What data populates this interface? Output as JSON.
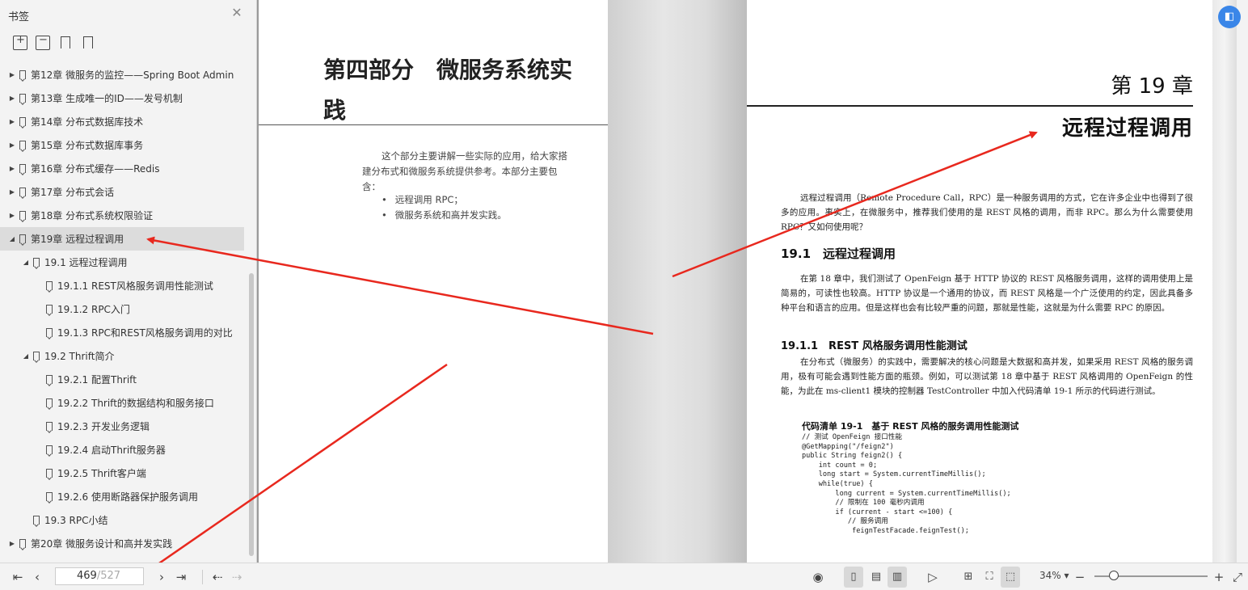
{
  "sidebar": {
    "title": "书签",
    "close_icon": "close-icon",
    "tools": [
      "expand-all-icon",
      "collapse-all-icon",
      "add-bookmark-icon",
      "bookmark-icon"
    ],
    "items": [
      {
        "label": "第12章 微服务的监控——Spring Boot Admin",
        "level": 0,
        "arrow": "▶"
      },
      {
        "label": "第13章 生成唯一的ID——发号机制",
        "level": 0,
        "arrow": "▶"
      },
      {
        "label": "第14章 分布式数据库技术",
        "level": 0,
        "arrow": "▶"
      },
      {
        "label": "第15章 分布式数据库事务",
        "level": 0,
        "arrow": "▶"
      },
      {
        "label": "第16章 分布式缓存——Redis",
        "level": 0,
        "arrow": "▶"
      },
      {
        "label": "第17章 分布式会话",
        "level": 0,
        "arrow": "▶"
      },
      {
        "label": "第18章 分布式系统权限验证",
        "level": 0,
        "arrow": "▶"
      },
      {
        "label": "第19章 远程过程调用",
        "level": 0,
        "arrow": "◢",
        "active": true
      },
      {
        "label": "19.1 远程过程调用",
        "level": 1,
        "arrow": "◢"
      },
      {
        "label": "19.1.1 REST风格服务调用性能测试",
        "level": 2,
        "arrow": ""
      },
      {
        "label": "19.1.2 RPC入门",
        "level": 2,
        "arrow": ""
      },
      {
        "label": "19.1.3 RPC和REST风格服务调用的对比",
        "level": 2,
        "arrow": ""
      },
      {
        "label": "19.2 Thrift简介",
        "level": 1,
        "arrow": "◢"
      },
      {
        "label": "19.2.1 配置Thrift",
        "level": 2,
        "arrow": ""
      },
      {
        "label": "19.2.2 Thrift的数据结构和服务接口",
        "level": 2,
        "arrow": ""
      },
      {
        "label": "19.2.3 开发业务逻辑",
        "level": 2,
        "arrow": ""
      },
      {
        "label": "19.2.4 启动Thrift服务器",
        "level": 2,
        "arrow": ""
      },
      {
        "label": "19.2.5 Thrift客户端",
        "level": 2,
        "arrow": ""
      },
      {
        "label": "19.2.6 使用断路器保护服务调用",
        "level": 2,
        "arrow": ""
      },
      {
        "label": "19.3 RPC小结",
        "level": 1,
        "arrow": ""
      },
      {
        "label": "第20章 微服务设计和高并发实践",
        "level": 0,
        "arrow": "▶"
      }
    ]
  },
  "left_page": {
    "part_title": "第四部分　微服务系统实践",
    "intro": "这个部分主要讲解一些实际的应用，给大家搭建分布式和微服务系统提供参考。本部分主要包含：",
    "bullets": [
      "远程调用 RPC；",
      "微服务系统和高并发实践。"
    ]
  },
  "right_page": {
    "chapter_number": "第 19 章",
    "chapter_title": "远程过程调用",
    "para1": "远程过程调用（Remote Procedure Call，RPC）是一种服务调用的方式，它在许多企业中也得到了很多的应用。事实上，在微服务中，推荐我们使用的是 REST 风格的调用，而非 RPC。那么为什么需要使用 RPC？又如何使用呢？",
    "h1": "19.1　远程过程调用",
    "para2": "在第 18 章中，我们测试了 OpenFeign 基于 HTTP 协议的 REST 风格服务调用，这样的调用使用上是简易的，可读性也较高。HTTP 协议是一个通用的协议，而 REST 风格是一个广泛使用的约定，因此具备多种平台和语言的应用。但是这样也会有比较严重的问题，那就是性能，这就是为什么需要 RPC 的原因。",
    "h2": "19.1.1　REST 风格服务调用性能测试",
    "para3": "在分布式（微服务）的实践中，需要解决的核心问题是大数据和高并发，如果采用 REST 风格的服务调用，极有可能会遇到性能方面的瓶颈。例如，可以测试第 18 章中基于 REST 风格调用的 OpenFeign 的性能，为此在 ms-client1 模块的控制器 TestController 中加入代码清单 19-1 所示的代码进行测试。",
    "listing_title": "代码清单 19-1　基于 REST 风格的服务调用性能测试",
    "code": "// 测试 OpenFeign 接口性能\n@GetMapping(\"/feign2\")\npublic String feign2() {\n    int count = 0;\n    long start = System.currentTimeMillis();\n    while(true) {\n        long current = System.currentTimeMillis();\n        // 限制在 100 毫秒内调用\n        if (current - start <=100) {\n           // 服务调用\n            feignTestFacade.feignTest();"
  },
  "bottombar": {
    "current_page": "469",
    "total_pages": "/527",
    "zoom": "34%",
    "zoom_level": 0.17
  },
  "colors": {
    "arrow": "#e8281e",
    "float_button": "#3a86e8"
  }
}
